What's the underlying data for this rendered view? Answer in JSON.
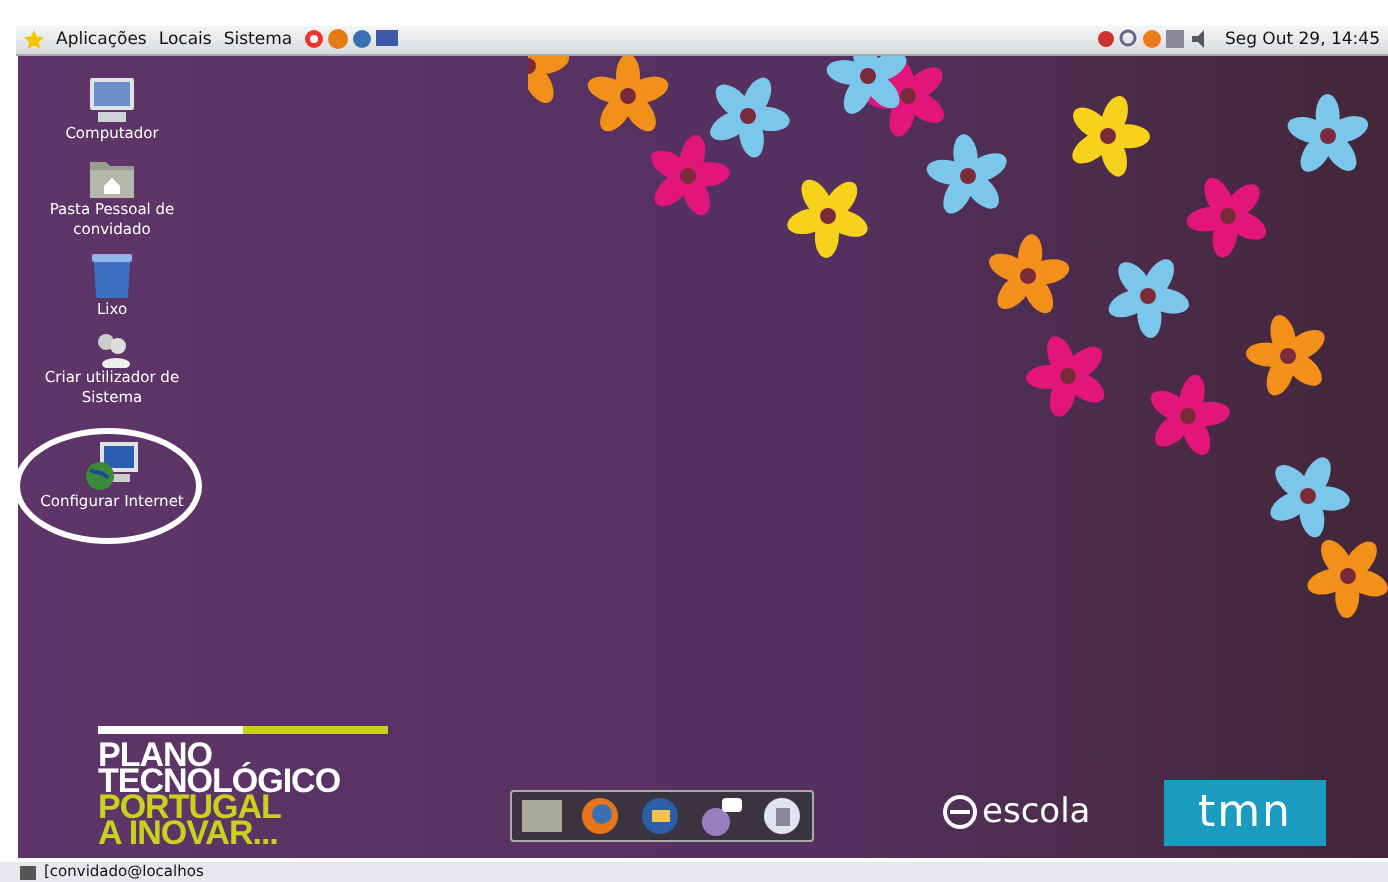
{
  "top_panel": {
    "menus": [
      "Aplicações",
      "Locais",
      "Sistema"
    ],
    "clock": "Seg Out 29, 14:45"
  },
  "desktop_icons": [
    {
      "kind": "computer",
      "label": "Computador"
    },
    {
      "kind": "folder",
      "label": "Pasta Pessoal de convidado"
    },
    {
      "kind": "trash",
      "label": "Lixo"
    },
    {
      "kind": "users",
      "label": "Criar utilizador de Sistema"
    },
    {
      "kind": "network",
      "label": "Configurar Internet",
      "circled": true
    }
  ],
  "branding": {
    "lines": [
      {
        "text": "PLANO",
        "kind": "white"
      },
      {
        "text": "TECNOLÓGICO",
        "kind": "white"
      },
      {
        "text": "PORTUGAL",
        "kind": "lime"
      },
      {
        "text": "A INOVAR...",
        "kind": "lime"
      }
    ],
    "escola": "escola",
    "tmn": "tmn"
  },
  "bottom_panel": {
    "task": "[convidado@localhos"
  }
}
